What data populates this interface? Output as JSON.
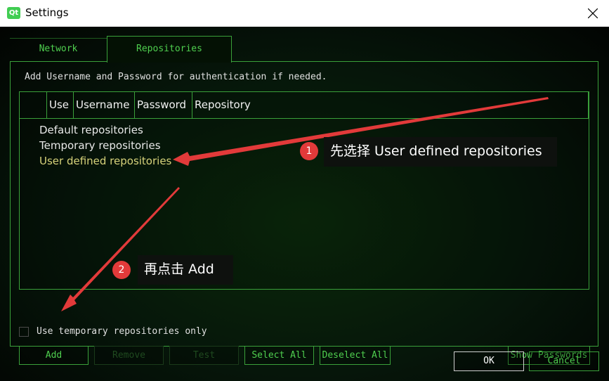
{
  "window": {
    "title": "Settings",
    "app_icon_text": "Qt"
  },
  "tabs": [
    {
      "label": "Network",
      "active": false
    },
    {
      "label": "Repositories",
      "active": true
    }
  ],
  "repositories": {
    "hint": "Add Username and Password for authentication if needed.",
    "columns": [
      "Use",
      "Username",
      "Password",
      "Repository"
    ],
    "tree_items": [
      {
        "label": "Default repositories",
        "selected": false
      },
      {
        "label": "Temporary repositories",
        "selected": false
      },
      {
        "label": "User defined repositories",
        "selected": true
      }
    ],
    "temp_checkbox_label": "Use temporary repositories only",
    "temp_checkbox_checked": false,
    "buttons": {
      "add": "Add",
      "remove": "Remove",
      "test": "Test",
      "select_all": "Select All",
      "deselect_all": "Deselect All",
      "show_passwords": "Show Passwords"
    }
  },
  "dialog_buttons": {
    "ok": "OK",
    "cancel": "Cancel"
  },
  "annotations": [
    {
      "number": "1",
      "text": "先选择 User defined repositories"
    },
    {
      "number": "2",
      "text": "再点击 Add"
    }
  ],
  "colors": {
    "accent": "#3aa03a",
    "text_green": "#4fcf4f",
    "selected": "#d7d27a",
    "arrow": "#e23a3a"
  },
  "icons": {
    "close": "close-icon",
    "app": "qt-app-icon"
  }
}
